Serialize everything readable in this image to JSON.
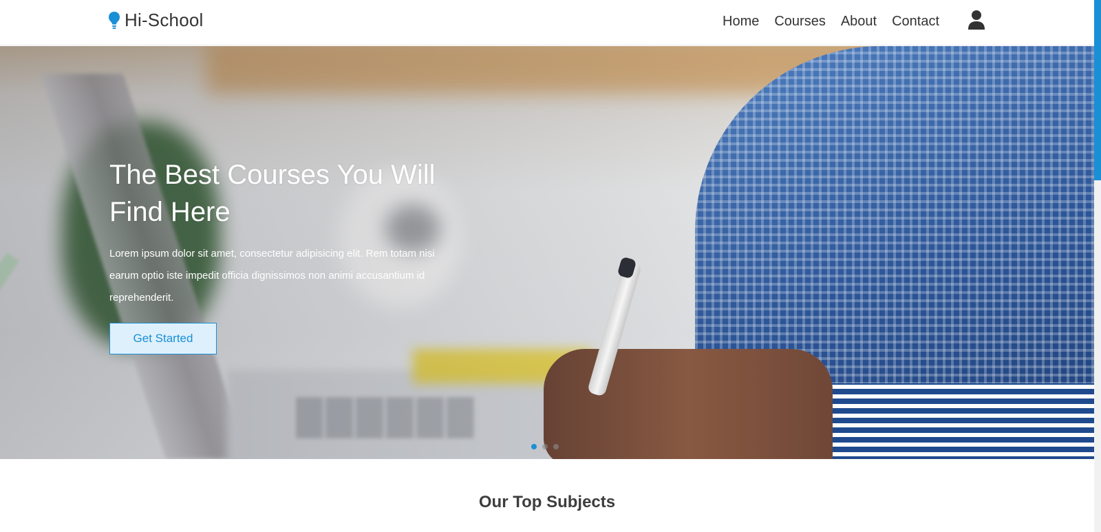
{
  "brand": {
    "name": "Hi-School",
    "icon": "lightbulb-icon",
    "color": "#1b8fd6"
  },
  "nav": {
    "items": [
      {
        "label": "Home"
      },
      {
        "label": "Courses"
      },
      {
        "label": "About"
      },
      {
        "label": "Contact"
      }
    ],
    "user_icon": "user-icon"
  },
  "hero": {
    "title": "The Best Courses You Will Find Here",
    "text": "Lorem ipsum dolor sit amet, consectetur adipisicing elit. Rem totam nisi earum optio iste impedit officia dignissimos non animi accusantium id reprehenderit.",
    "button_label": "Get Started",
    "slides": 3,
    "active_slide": 1
  },
  "section": {
    "title": "Our Top Subjects"
  },
  "colors": {
    "accent": "#1b8fd6",
    "text": "#333333"
  }
}
